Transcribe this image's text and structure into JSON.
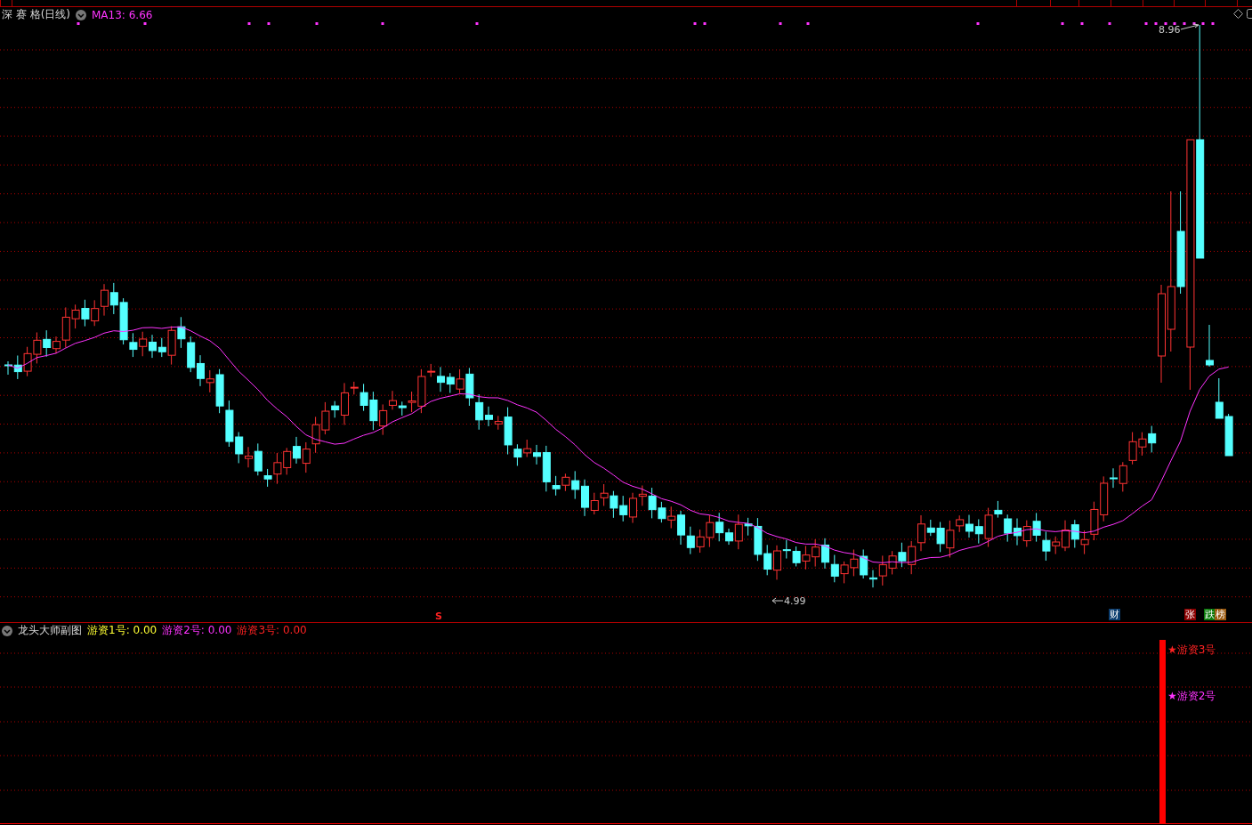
{
  "main_chart": {
    "title": "深 赛 格(日线)",
    "indicator": {
      "label": "MA13: 6.66",
      "color": "#ff33ff"
    },
    "high_label": "8.96",
    "low_label": "4.99",
    "signal_mark": "S",
    "event_markers": [
      {
        "text": "财",
        "color": "#0b3d6e"
      },
      {
        "text": "张",
        "color": "#8b0000"
      },
      {
        "text": "跌",
        "color": "#0a7a0a"
      },
      {
        "text": "榜",
        "color": "#9a5a10"
      }
    ]
  },
  "sub_chart": {
    "title": "龙头大师副图",
    "readings": [
      {
        "text": "游资1号: 0.00",
        "color": "#ffff33"
      },
      {
        "text": "游资2号: 0.00",
        "color": "#ff33ff"
      },
      {
        "text": "游资3号: 0.00",
        "color": "#ff2222"
      }
    ],
    "signals": [
      {
        "text": "★游资3号",
        "color": "#ff2222"
      },
      {
        "text": "★游资2号",
        "color": "#ff33ff"
      }
    ]
  }
}
